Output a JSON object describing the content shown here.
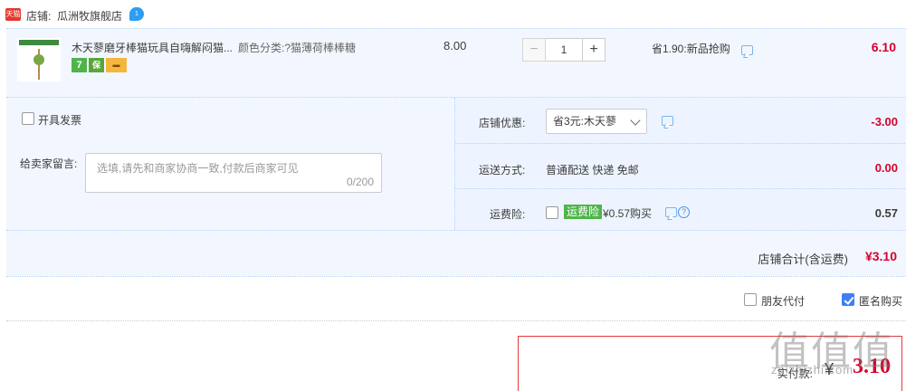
{
  "shop": {
    "badge": "天猫",
    "label": "店铺:",
    "name": "瓜洲牧旗舰店",
    "chat_badge": "1"
  },
  "item": {
    "title": "木天蓼磨牙棒猫玩具自嗨解闷猫...",
    "sku": "颜色分类:?猫薄荷棒棒糖",
    "service_icons": [
      "seven-day-return-icon",
      "insurance-icon",
      "credit-card-icon"
    ],
    "service_text": {
      "seven": "7",
      "ins": "保",
      "card": "▬"
    },
    "unit_price": "8.00",
    "quantity": {
      "minus": "−",
      "value": "1",
      "plus": "+"
    },
    "promo": "省1.90:新品抢购",
    "total": "6.10"
  },
  "invoice": {
    "label": "开具发票",
    "checked": false
  },
  "message": {
    "label": "给卖家留言:",
    "placeholder": "选填,请先和商家协商一致,付款后商家可见",
    "counter": "0/200"
  },
  "shop_discount": {
    "label": "店铺优惠:",
    "selected": "省3元:木天蓼",
    "amount": "-3.00"
  },
  "shipping": {
    "label": "运送方式:",
    "value": "普通配送 快递 免邮",
    "amount": "0.00"
  },
  "shipping_insurance": {
    "label": "运费险:",
    "tag": "运费险",
    "text": "¥0.57购买",
    "help": "?",
    "amount": "0.57",
    "checked": false
  },
  "shop_total": {
    "label": "店铺合计(含运费)",
    "amount": "¥3.10"
  },
  "bottom_options": {
    "friend_pay": {
      "label": "朋友代付",
      "checked": false
    },
    "anonymous": {
      "label": "匿名购买",
      "checked": true
    }
  },
  "payment": {
    "label": "实付款:",
    "currency": "¥",
    "amount": "3.10"
  },
  "watermark": {
    "big": "值值值",
    "small": "zhizhizhi.com"
  },
  "colors": {
    "accent_red": "#d6002d",
    "light_blue_bg": "#f2f7ff",
    "checkbox_blue": "#3d7ff4",
    "service_green": "#4fb54b"
  }
}
